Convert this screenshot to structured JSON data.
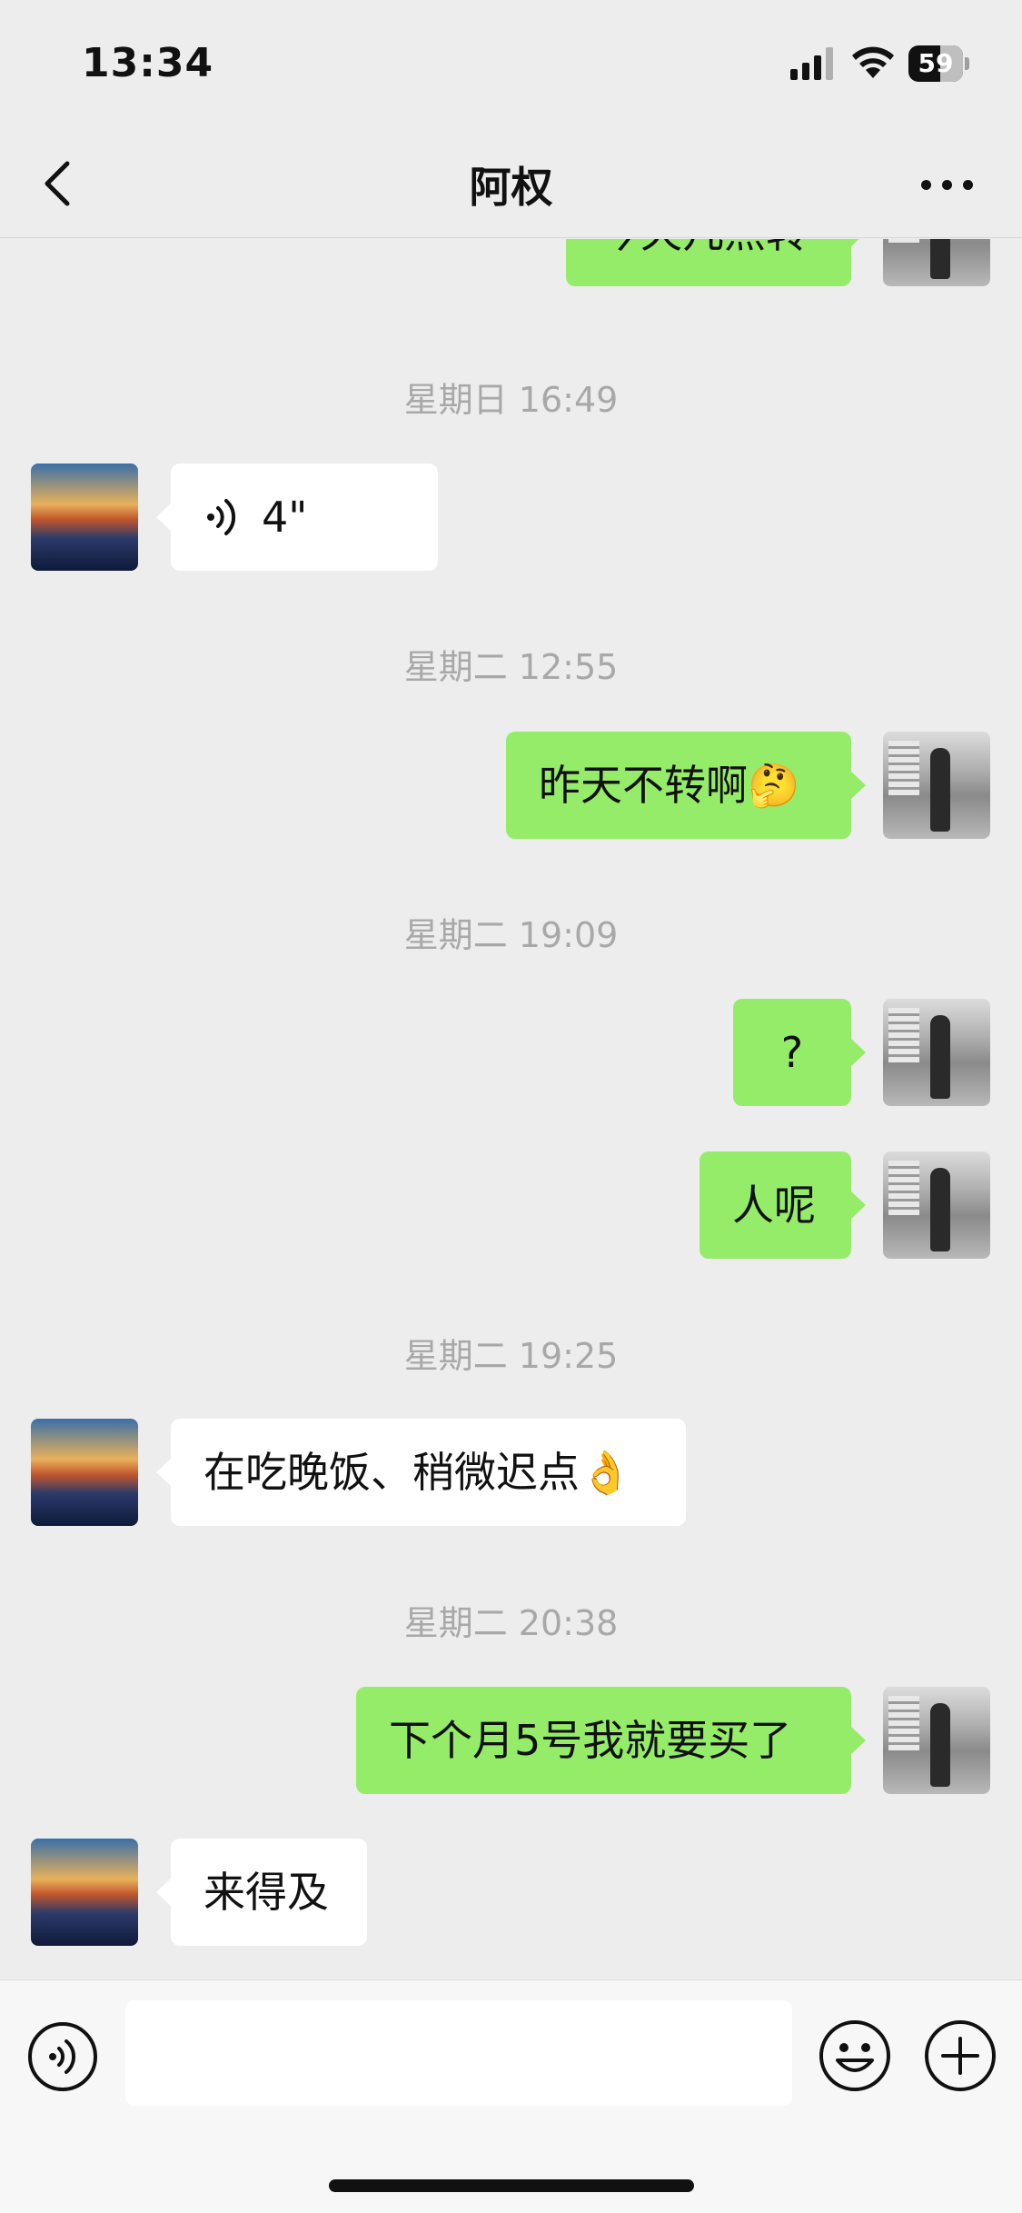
{
  "status_bar": {
    "time": "13:34",
    "battery_level": "59",
    "battery_fraction": 0.59,
    "icons": [
      "signal-icon",
      "wifi-icon",
      "battery-icon"
    ]
  },
  "header": {
    "title": "阿权",
    "back_icon": "chevron-left-icon",
    "more_icon": "more-dots-icon"
  },
  "messages": {
    "m0": {
      "sender": "me",
      "text": "今天几点转"
    },
    "t1": "星期日 16:49",
    "m1": {
      "sender": "other",
      "type": "voice",
      "duration": "4\""
    },
    "t2": "星期二 12:55",
    "m2": {
      "sender": "me",
      "text": "昨天不转啊🤔"
    },
    "t3": "星期二 19:09",
    "m3": {
      "sender": "me",
      "text": "?"
    },
    "m4": {
      "sender": "me",
      "text": "人呢"
    },
    "t4": "星期二 19:25",
    "m5": {
      "sender": "other",
      "text": "在吃晚饭、稍微迟点👌"
    },
    "t5": "星期二 20:38",
    "m6": {
      "sender": "me",
      "text": "下个月5号我就要买了"
    },
    "m7": {
      "sender": "other",
      "text": "来得及"
    }
  },
  "input_bar": {
    "placeholder": "",
    "icons": [
      "voice-input-icon",
      "emoji-icon",
      "plus-icon"
    ]
  },
  "colors": {
    "background": "#ededed",
    "my_bubble": "#95ec69",
    "other_bubble": "#ffffff",
    "timestamp": "#a8a8a8"
  }
}
